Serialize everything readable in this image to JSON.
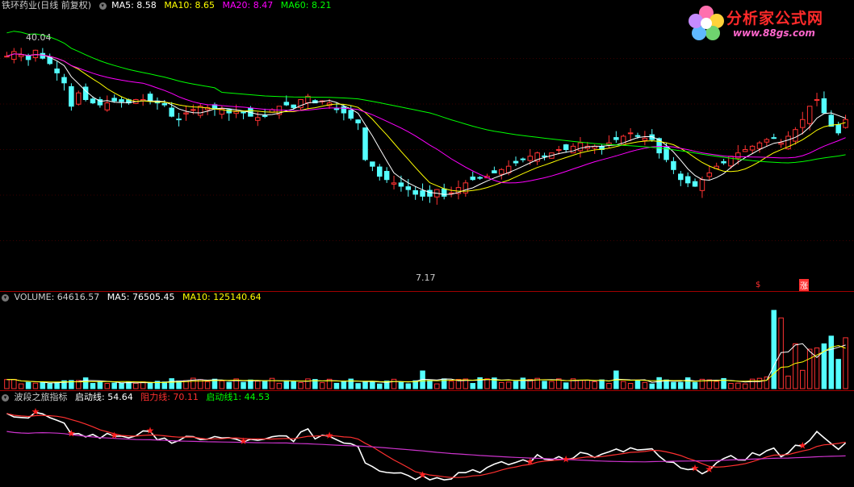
{
  "price_panel": {
    "stock_name": "铁环药业(日线 前复权)",
    "ma5": "MA5: 8.58",
    "ma10": "MA10: 8.65",
    "ma20": "MA20: 8.47",
    "ma60": "MA60: 8.21",
    "high_label": "40.04",
    "low_label": "7.17",
    "signal_1": "$",
    "signal_2": "涨",
    "colors": {
      "ma5": "#ffffff",
      "ma10": "#ffff00",
      "ma20": "#ff00ff",
      "ma60": "#00ff00",
      "up": "#ff3232",
      "down": "#54ffff"
    }
  },
  "volume_panel": {
    "volume": "VOLUME: 64616.57",
    "ma5": "MA5: 76505.45",
    "ma10": "MA10: 125140.64"
  },
  "indicator_panel": {
    "name": "波段之旅指标",
    "start_line": "启动线: 54.64",
    "resistance_line": "阻力线: 70.11",
    "start_line_1": "启动线1: 44.53"
  },
  "watermark": {
    "text": "分析家公式网",
    "url": "www.88gs.com",
    "icon": "flower-logo-icon"
  },
  "chart_data": {
    "type": "candlestick",
    "price_range": [
      6.5,
      10.6
    ],
    "closes": [
      9.95,
      10.02,
      9.97,
      9.9,
      10.04,
      9.92,
      9.84,
      9.7,
      9.55,
      9.2,
      9.4,
      9.3,
      9.25,
      9.22,
      9.25,
      9.28,
      9.27,
      9.25,
      9.3,
      9.3,
      9.28,
      9.25,
      9.22,
      9.05,
      9.0,
      9.1,
      9.15,
      9.2,
      9.18,
      9.17,
      9.16,
      9.1,
      9.12,
      9.1,
      9.05,
      9.03,
      9.05,
      9.15,
      9.2,
      9.22,
      9.18,
      9.3,
      9.35,
      9.25,
      9.28,
      9.25,
      9.15,
      9.1,
      9.02,
      8.95,
      8.4,
      8.3,
      8.15,
      8.1,
      8.05,
      8.0,
      7.95,
      7.88,
      7.85,
      7.85,
      7.95,
      7.85,
      7.9,
      7.98,
      8.05,
      8.1,
      8.12,
      8.15,
      8.2,
      8.25,
      8.3,
      8.35,
      8.4,
      8.45,
      8.5,
      8.45,
      8.5,
      8.55,
      8.55,
      8.6,
      8.65,
      8.6,
      8.6,
      8.55,
      8.65,
      8.7,
      8.75,
      8.8,
      8.75,
      8.72,
      8.7,
      8.5,
      8.4,
      8.25,
      8.1,
      8.05,
      8.0,
      8.1,
      8.2,
      8.3,
      8.35,
      8.45,
      8.5,
      8.55,
      8.6,
      8.65,
      8.7,
      8.72,
      8.65,
      8.75,
      8.85,
      9.0,
      9.2,
      9.3,
      9.1,
      8.9,
      8.8,
      9.0
    ],
    "volume_range": [
      0,
      450000
    ],
    "indicator_range": [
      30,
      90
    ]
  }
}
